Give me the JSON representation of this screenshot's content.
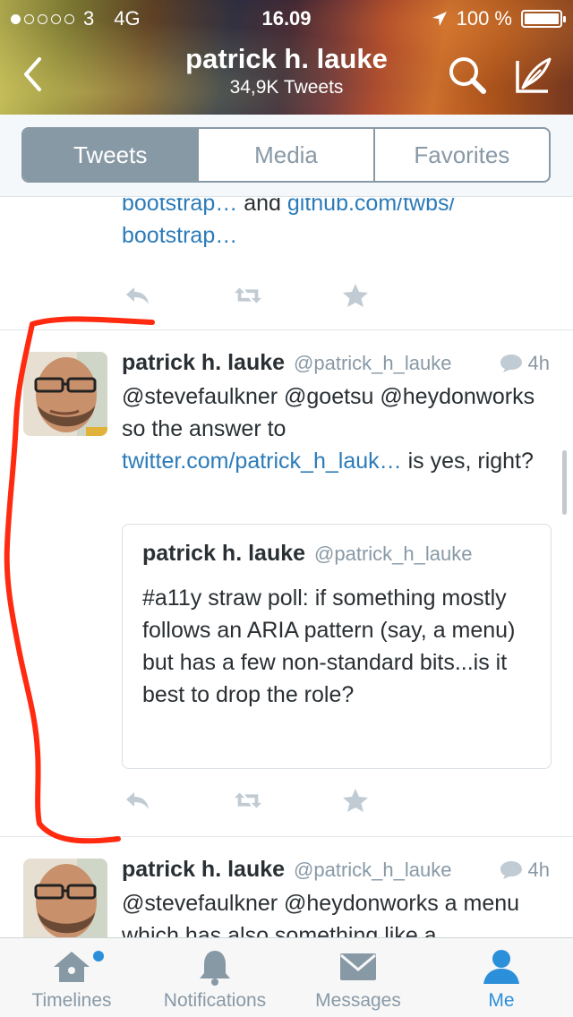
{
  "status_bar": {
    "carrier": "3",
    "network": "4G",
    "time": "16.09",
    "battery": "100 %"
  },
  "header": {
    "name": "patrick h. lauke",
    "tweet_count": "34,9K Tweets"
  },
  "tabs": [
    {
      "label": "Tweets",
      "active": true
    },
    {
      "label": "Media",
      "active": false
    },
    {
      "label": "Favorites",
      "active": false
    }
  ],
  "tweets": [
    {
      "text_line1_link": "bootstrap…",
      "text_line1_rest": " and ",
      "text_line1_link2": "github.com/twbs/",
      "text_line2_link": "bootstrap…"
    },
    {
      "name": "patrick h. lauke",
      "handle": "@patrick_h_lauke",
      "time": "4h",
      "text_part1": "@stevefaulkner @goetsu @heydonworks so the answer to ",
      "text_link": "twitter.com/patrick_h_lauk…",
      "text_part2": " is yes, right?",
      "quote": {
        "name": "patrick h. lauke",
        "handle": "@patrick_h_lauke",
        "text": "#a11y straw poll: if something mostly follows an ARIA pattern (say, a menu) but has a few non-standard bits...is it best to drop the role?"
      }
    },
    {
      "name": "patrick h. lauke",
      "handle": "@patrick_h_lauke",
      "time": "4h",
      "text": "@stevefaulkner @heydonworks a menu which has also something like a"
    }
  ],
  "tabbar": [
    {
      "label": "Timelines",
      "icon": "home-icon",
      "active": false
    },
    {
      "label": "Notifications",
      "icon": "bell-icon",
      "active": false
    },
    {
      "label": "Messages",
      "icon": "envelope-icon",
      "active": false
    },
    {
      "label": "Me",
      "icon": "person-icon",
      "active": true
    }
  ],
  "colors": {
    "link": "#2b7bb9",
    "muted": "#8899a6",
    "active_tab": "#2b8fd9",
    "annotation": "#ff2a10"
  }
}
